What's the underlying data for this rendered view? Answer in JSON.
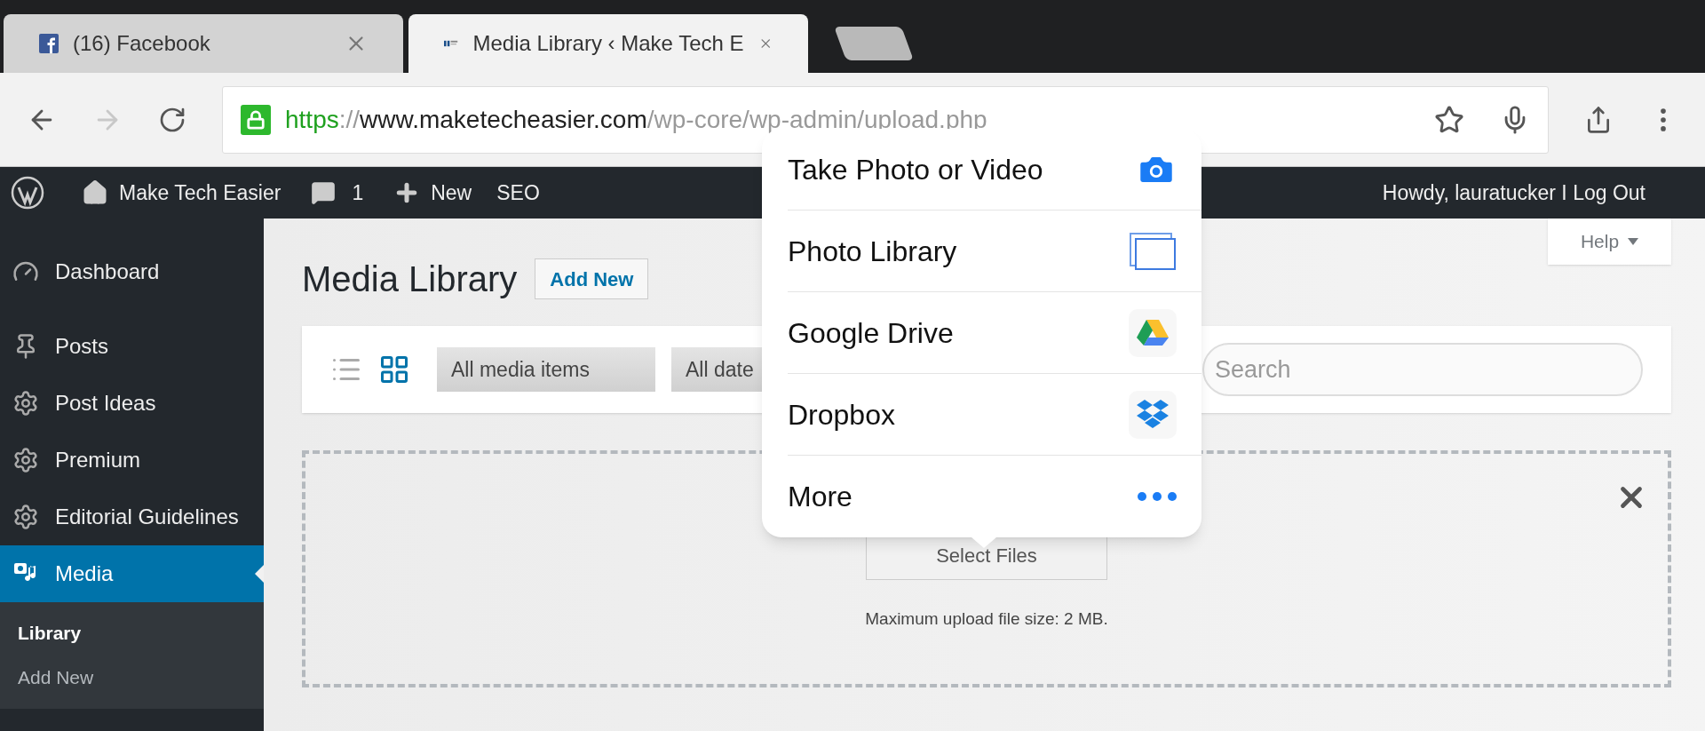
{
  "browser": {
    "tabs": [
      {
        "title": "(16) Facebook",
        "selected": false
      },
      {
        "title": "Media Library ‹ Make Tech E",
        "selected": true
      }
    ],
    "address_bar": {
      "scheme": "https",
      "separator": "://",
      "host": "www.maketecheasier.com",
      "path": "/wp-core/wp-admin/upload.php"
    }
  },
  "admin_bar": {
    "site_name": "Make Tech Easier",
    "comments": "1",
    "new": "New",
    "seo": "SEO",
    "account": "Howdy, lauratucker I Log Out"
  },
  "sidebar": {
    "items": [
      {
        "label": "Dashboard",
        "selected": false
      },
      {
        "label": "Posts",
        "selected": false
      },
      {
        "label": "Post Ideas",
        "selected": false
      },
      {
        "label": "Premium",
        "selected": false
      },
      {
        "label": "Editorial Guidelines",
        "selected": false
      },
      {
        "label": "Media",
        "selected": true,
        "children": [
          {
            "label": "Library",
            "selected": true
          },
          {
            "label": "Add New",
            "selected": false
          }
        ]
      }
    ]
  },
  "page": {
    "title": "Media Library",
    "add_new": "Add New",
    "help": "Help",
    "toolbar": {
      "views": [
        {
          "selected": false
        },
        {
          "selected": true
        }
      ],
      "filters": [
        "All media items",
        "All date"
      ],
      "search": {
        "placeholder": "Search"
      }
    },
    "upload": {
      "button": "Select Files",
      "note": "Maximum upload file size: 2 MB."
    }
  },
  "popover": {
    "items": [
      {
        "label": "Take Photo or Video",
        "kind": "camera"
      },
      {
        "label": "Photo Library",
        "kind": "library"
      },
      {
        "label": "Google Drive",
        "kind": "drive"
      },
      {
        "label": "Dropbox",
        "kind": "dropbox"
      },
      {
        "label": "More",
        "kind": "more"
      }
    ]
  }
}
